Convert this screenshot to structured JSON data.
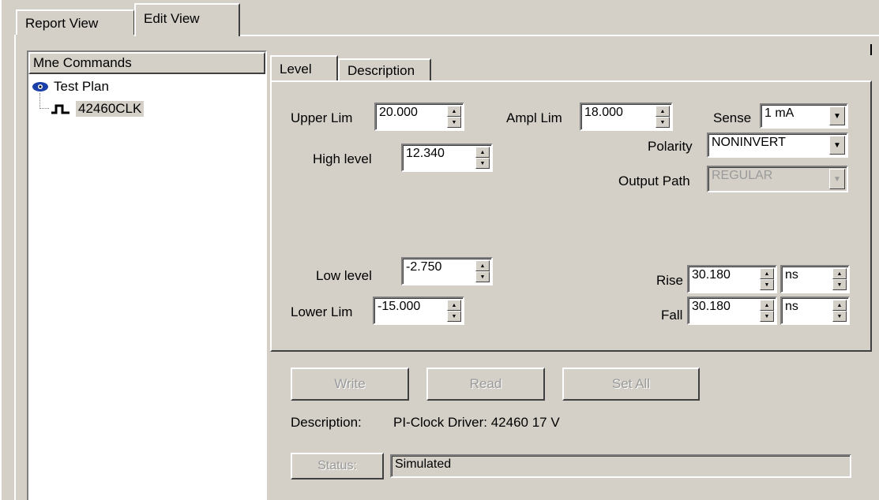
{
  "top_tabs": [
    {
      "label": "Report View"
    },
    {
      "label": "Edit View"
    }
  ],
  "tree": {
    "header": "Mne Commands",
    "root": "Test Plan",
    "child": "42460CLK"
  },
  "inner_tabs": [
    {
      "label": "Level"
    },
    {
      "label": "Description"
    }
  ],
  "fields": {
    "upper_lim": {
      "label": "Upper Lim",
      "value": "20.000"
    },
    "ampl_lim": {
      "label": "Ampl Lim",
      "value": "18.000"
    },
    "sense": {
      "label": "Sense",
      "value": "1 mA"
    },
    "high_level": {
      "label": "High level",
      "value": "12.340"
    },
    "polarity": {
      "label": "Polarity",
      "value": "NONINVERT"
    },
    "output_path": {
      "label": "Output Path",
      "value": "REGULAR"
    },
    "low_level": {
      "label": "Low level",
      "value": "-2.750"
    },
    "lower_lim": {
      "label": "Lower Lim",
      "value": "-15.000"
    },
    "rise": {
      "label": "Rise",
      "value": "30.180",
      "unit": "ns"
    },
    "fall": {
      "label": "Fall",
      "value": "30.180",
      "unit": "ns"
    }
  },
  "actions": {
    "write": "Write",
    "read": "Read",
    "set_all": "Set All",
    "status_button": "Status:"
  },
  "description": {
    "label": "Description:",
    "value": "PI-Clock Driver: 42460 17 V"
  },
  "status_value": "Simulated"
}
